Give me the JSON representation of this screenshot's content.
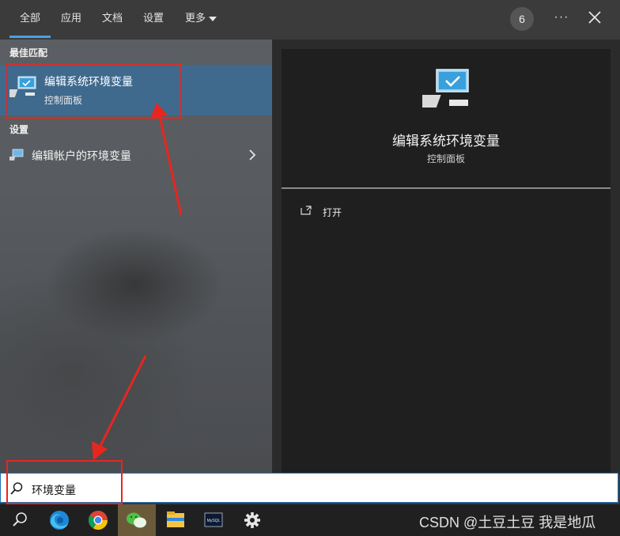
{
  "tabs": [
    {
      "label": "全部"
    },
    {
      "label": "应用"
    },
    {
      "label": "文档"
    },
    {
      "label": "设置"
    },
    {
      "label": "更多"
    }
  ],
  "header": {
    "badge_count": "6",
    "more_options_icon": "ellipsis-icon",
    "close_icon": "close-icon"
  },
  "results": {
    "best_match_heading": "最佳匹配",
    "best_match": {
      "title": "编辑系统环境变量",
      "subtitle": "控制面板",
      "icon": "computer-monitor-icon"
    },
    "settings_heading": "设置",
    "settings_items": [
      {
        "label": "编辑帐户的环境变量",
        "icon": "user-computer-icon"
      }
    ]
  },
  "details": {
    "title": "编辑系统环境变量",
    "subtitle": "控制面板",
    "actions": [
      {
        "label": "打开",
        "icon": "open-window-icon"
      }
    ]
  },
  "search": {
    "value": "环境变量",
    "icon": "search-icon"
  },
  "taskbar": {
    "icons": [
      "search-icon",
      "edge-icon",
      "chrome-icon",
      "wechat-icon",
      "file-explorer-icon",
      "mysql-icon",
      "settings-gear-icon"
    ],
    "mysql_label": "MySQL"
  },
  "watermark": "CSDN @土豆土豆 我是地瓜",
  "colors": {
    "accent": "#4aa0e6",
    "selection": "#3f6a8e",
    "annotation": "#e8261e"
  }
}
